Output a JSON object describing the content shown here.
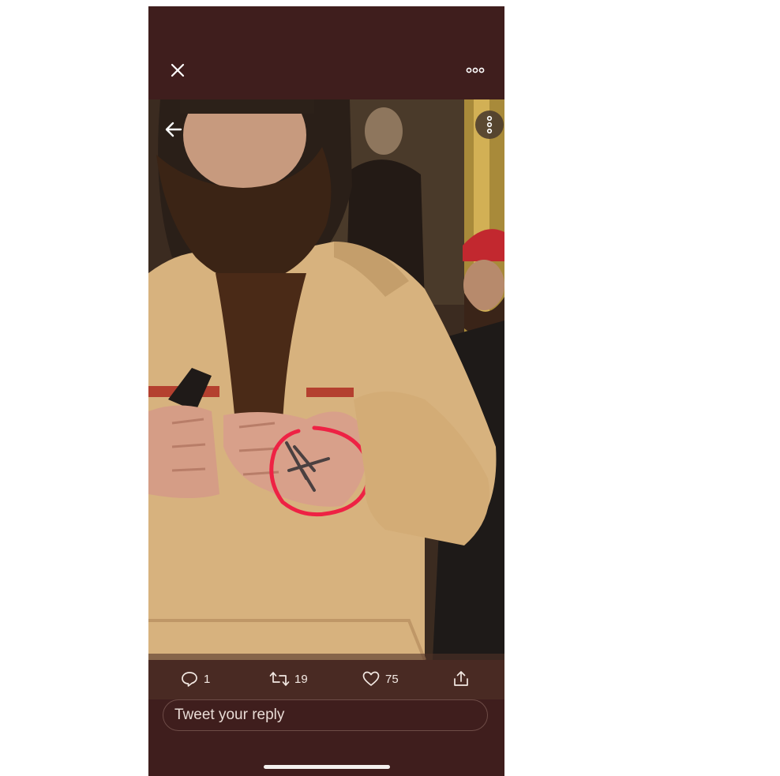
{
  "colors": {
    "background": "#3f1e1d",
    "icon": "#ffffff",
    "annotation_circle": "#ee2244"
  },
  "toolbar": {
    "close_icon": "close-icon",
    "more_icon": "more-horizontal-icon"
  },
  "media": {
    "back_icon": "arrow-left-icon",
    "more_icon": "more-vertical-icon"
  },
  "actions": {
    "reply_count": "1",
    "retweet_count": "19",
    "like_count": "75",
    "share_icon": "share-icon"
  },
  "reply": {
    "placeholder": "Tweet your reply"
  }
}
